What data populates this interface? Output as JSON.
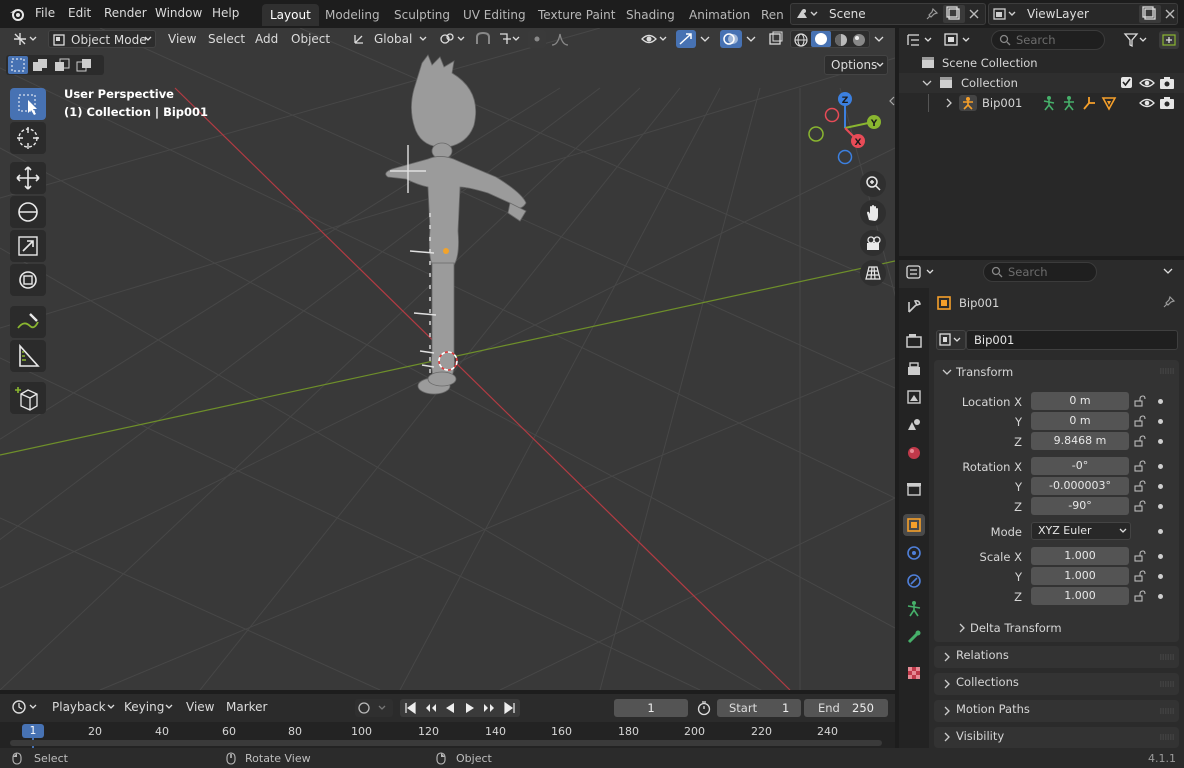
{
  "top_menu": {
    "items": [
      "File",
      "Edit",
      "Render",
      "Window",
      "Help"
    ],
    "workspaces": [
      "Layout",
      "Modeling",
      "Sculpting",
      "UV Editing",
      "Texture Paint",
      "Shading",
      "Animation",
      "Rend"
    ],
    "active_workspace": "Layout",
    "scene": "Scene",
    "view_layer": "ViewLayer"
  },
  "viewport": {
    "mode": "Object Mode",
    "menus": [
      "View",
      "Select",
      "Add",
      "Object"
    ],
    "transform_orientation": "Global",
    "options_label": "Options",
    "overlay_title": "User Perspective",
    "overlay_subtitle": "(1) Collection | Bip001",
    "gizmo": {
      "z": "Z",
      "y": "Y",
      "x": "X"
    }
  },
  "timeline": {
    "menus": [
      "Playback",
      "Keying",
      "View",
      "Marker"
    ],
    "current_frame": "1",
    "start_label": "Start",
    "start_value": "1",
    "end_label": "End",
    "end_value": "250",
    "ruler_ticks": [
      "1",
      "20",
      "40",
      "60",
      "80",
      "100",
      "120",
      "140",
      "160",
      "180",
      "200",
      "220",
      "240"
    ]
  },
  "outliner": {
    "search_placeholder": "Search",
    "scene_collection": "Scene Collection",
    "collection": "Collection",
    "object": "Bip001"
  },
  "properties": {
    "search_placeholder": "Search",
    "object_name": "Bip001",
    "object_field": "Bip001",
    "transform_header": "Transform",
    "location": {
      "label_x": "Location X",
      "label_y": "Y",
      "label_z": "Z",
      "x": "0 m",
      "y": "0 m",
      "z": "9.8468 m"
    },
    "rotation": {
      "label_x": "Rotation X",
      "label_y": "Y",
      "label_z": "Z",
      "x": "-0°",
      "y": "-0.000003°",
      "z": "-90°"
    },
    "mode": {
      "label": "Mode",
      "value": "XYZ Euler"
    },
    "scale": {
      "label_x": "Scale X",
      "label_y": "Y",
      "label_z": "Z",
      "x": "1.000",
      "y": "1.000",
      "z": "1.000"
    },
    "delta_transform": "Delta Transform",
    "panels": [
      "Relations",
      "Collections",
      "Motion Paths",
      "Visibility"
    ]
  },
  "status_bar": {
    "select": "Select",
    "rotate_view": "Rotate View",
    "object": "Object",
    "version": "4.1.1"
  },
  "colors": {
    "accent": "#4772b3",
    "x_axis": "#e84b57",
    "y_axis": "#8ab630",
    "z_axis": "#3c80e0",
    "active_tab": "#f59f2a"
  }
}
